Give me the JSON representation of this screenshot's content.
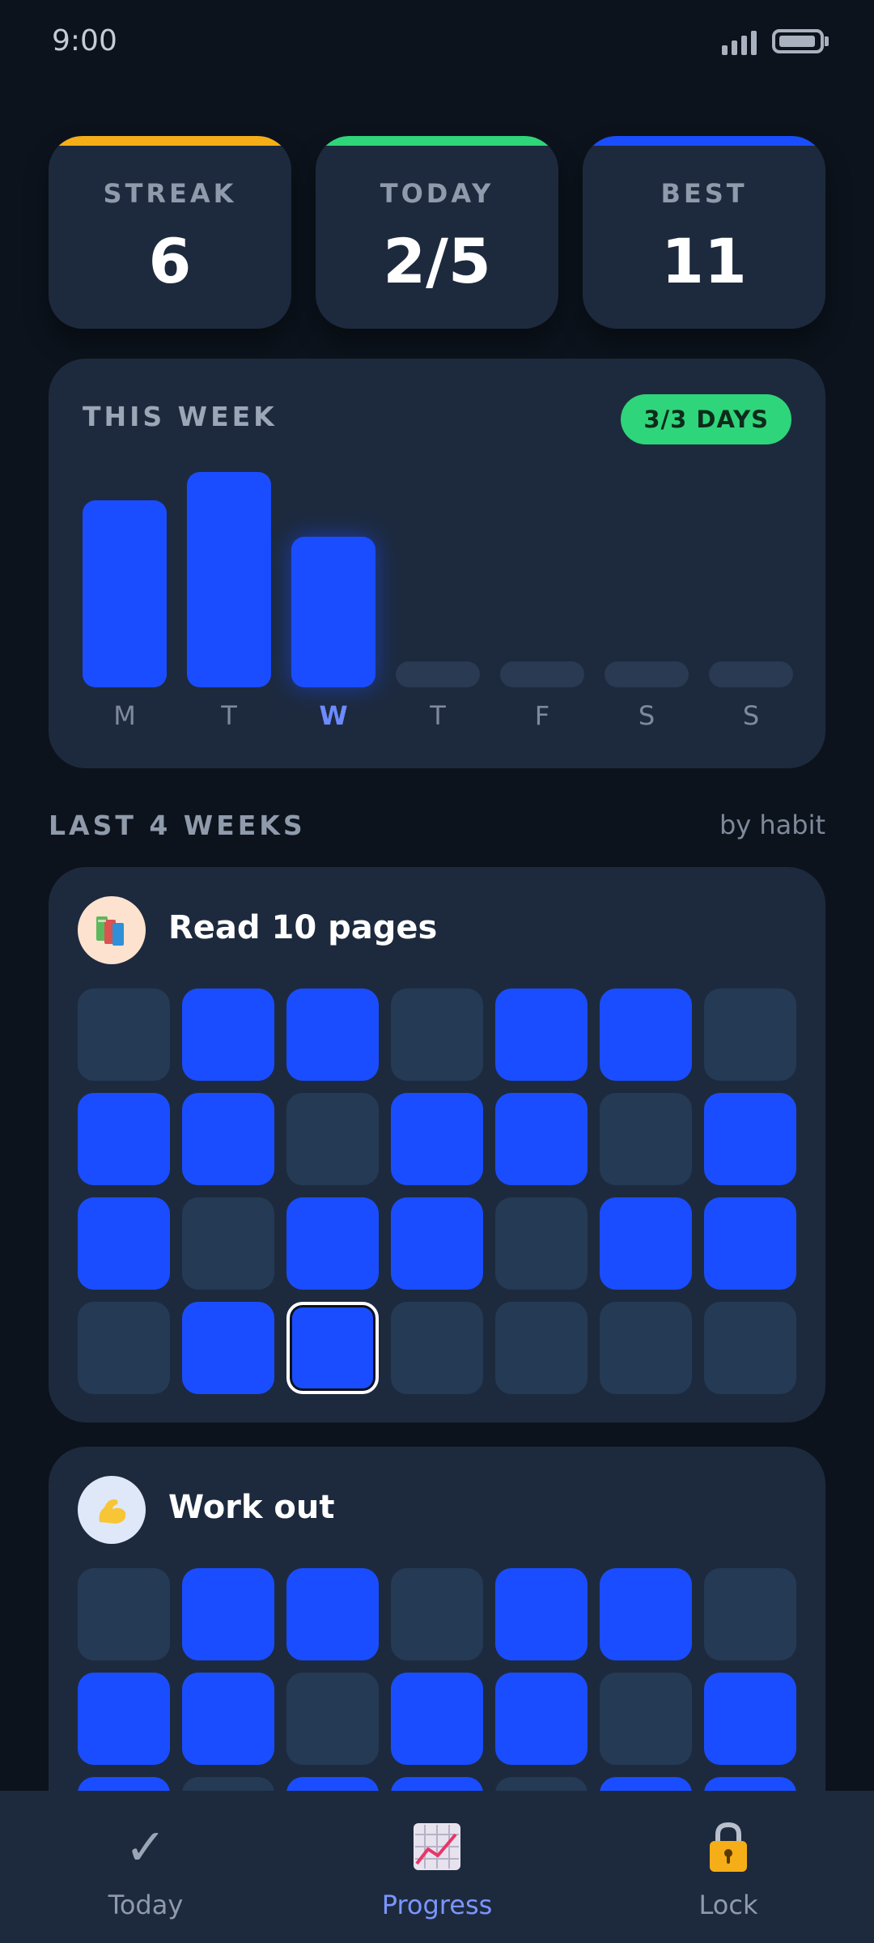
{
  "status_bar": {
    "time": "9:00"
  },
  "stats": [
    {
      "label": "STREAK",
      "value": "6",
      "accent": "#f5ae17"
    },
    {
      "label": "TODAY",
      "value": "2/5",
      "accent": "#2fd57a"
    },
    {
      "label": "BEST",
      "value": "11",
      "accent": "#1a4dff"
    }
  ],
  "week": {
    "title": "THIS WEEK",
    "badge": "3/3 DAYS",
    "days": [
      "M",
      "T",
      "W",
      "T",
      "F",
      "S",
      "S"
    ],
    "current_day_index": 2,
    "levels": [
      0.87,
      1.0,
      0.7,
      0,
      0,
      0,
      0
    ]
  },
  "history": {
    "title": "LAST 4 WEEKS",
    "filter": "by habit"
  },
  "habits": [
    {
      "name": "Read 10 pages",
      "icon": "books-icon",
      "grid": [
        [
          0,
          1,
          1,
          0,
          1,
          1,
          0
        ],
        [
          1,
          1,
          0,
          1,
          1,
          0,
          1
        ],
        [
          1,
          0,
          1,
          1,
          0,
          1,
          1
        ],
        [
          0,
          1,
          1,
          0,
          0,
          0,
          0
        ]
      ],
      "today_cell": [
        3,
        2
      ]
    },
    {
      "name": "Work out",
      "icon": "flexed-biceps-icon",
      "grid": [
        [
          0,
          1,
          1,
          0,
          1,
          1,
          0
        ],
        [
          1,
          1,
          0,
          1,
          1,
          0,
          1
        ],
        [
          1,
          0,
          1,
          1,
          0,
          1,
          1
        ]
      ]
    }
  ],
  "tabs": [
    {
      "label": "Today",
      "icon": "check-icon",
      "active": false
    },
    {
      "label": "Progress",
      "icon": "chart-icon",
      "active": true
    },
    {
      "label": "Lock",
      "icon": "lock-icon",
      "active": false
    }
  ],
  "colors": {
    "background": "#0c131c",
    "card": "#1d2a3e",
    "primary": "#1a4dff",
    "success": "#2fd57a",
    "streak": "#f5ae17"
  }
}
